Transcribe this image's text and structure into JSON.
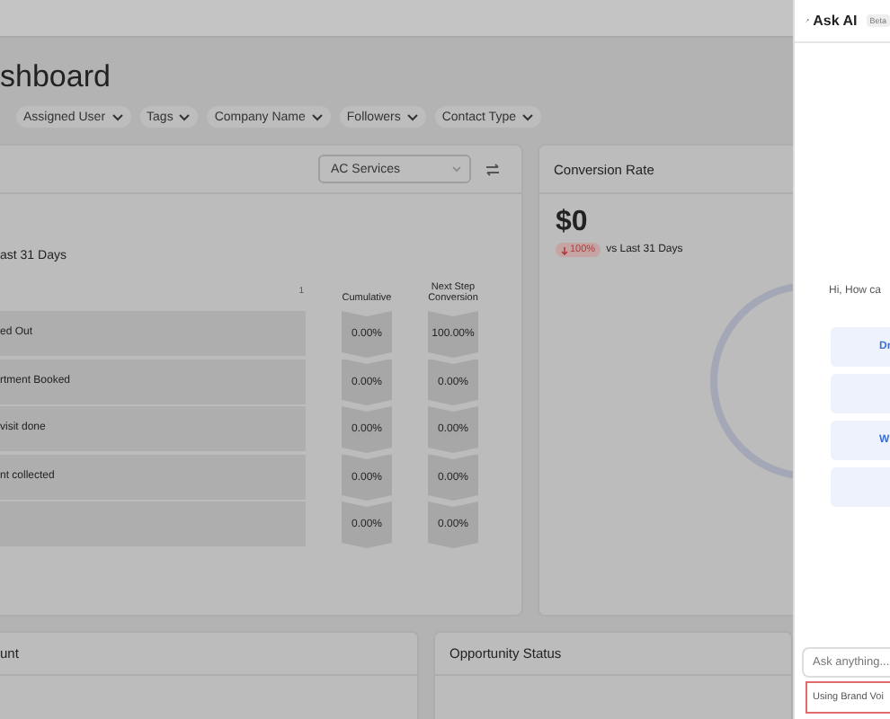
{
  "dashboard": {
    "title": "shboard",
    "filters": [
      {
        "label": "Assigned User"
      },
      {
        "label": "Tags"
      },
      {
        "label": "Company Name"
      },
      {
        "label": "Followers"
      },
      {
        "label": "Contact Type"
      }
    ]
  },
  "funnel": {
    "dropdown": "AC Services",
    "subtitle": "ast 31 Days",
    "axis_label": "1",
    "columns": [
      "Cumulative",
      "Next Step Conversion"
    ],
    "stages": [
      {
        "name": "ed Out",
        "cumulative": "0.00%",
        "next_step": "100.00%"
      },
      {
        "name": "rtment Booked",
        "cumulative": "0.00%",
        "next_step": "0.00%"
      },
      {
        "name": "visit done",
        "cumulative": "0.00%",
        "next_step": "0.00%"
      },
      {
        "name": "nt collected",
        "cumulative": "0.00%",
        "next_step": "0.00%"
      },
      {
        "cumulative": "0.00%",
        "next_step": "0.00%"
      }
    ]
  },
  "conversion": {
    "title": "Conversion Rate",
    "value": "$0",
    "change": "100%",
    "comparison": "vs Last 31 Days"
  },
  "bottom_cards": [
    {
      "title": "unt"
    },
    {
      "title": "Opportunity Status"
    }
  ],
  "ai_panel": {
    "title": "Ask AI",
    "badge": "Beta",
    "greeting": "Hi, How ca",
    "suggestions": [
      {
        "kind": "text",
        "label": "Dr"
      },
      {
        "kind": "blank"
      },
      {
        "kind": "text",
        "label": "W"
      },
      {
        "kind": "blank"
      }
    ],
    "input": {
      "placeholder": "Ask anything..."
    },
    "brand_voice": "Using Brand Voi"
  }
}
